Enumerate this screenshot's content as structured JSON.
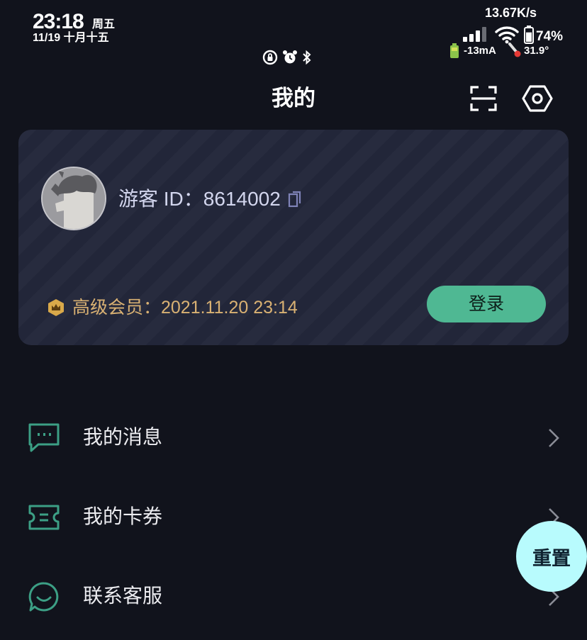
{
  "status_bar": {
    "time": "23:18",
    "weekday": "周五",
    "date": "11/19 十月十五",
    "net_speed": "13.67K/s",
    "battery_pct": "74%",
    "current": "-13mA",
    "temperature": "31.9°",
    "battery_level_pct": 74
  },
  "header": {
    "title": "我的",
    "icons": [
      "scan-icon",
      "settings-hexagon-icon"
    ]
  },
  "profile": {
    "user_id_label": "游客 ID：8614002",
    "membership": "高级会员：2021.11.20 23:14",
    "login_button": "登录"
  },
  "menu": [
    {
      "label": "我的消息",
      "icon": "message-icon"
    },
    {
      "label": "我的卡券",
      "icon": "coupon-icon"
    },
    {
      "label": "联系客服",
      "icon": "customer-service-icon"
    }
  ],
  "fab_label": "重置",
  "colors": {
    "background": "#11131c",
    "card": "#222639",
    "accent_green": "#4fb893",
    "gold": "#d9b173",
    "menu_icon": "#3c9f85",
    "fab": "#b8fbfd"
  }
}
